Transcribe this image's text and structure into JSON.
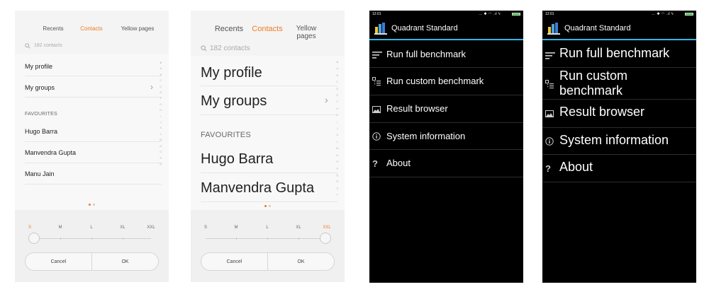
{
  "miui_panel_small": {
    "tabs": [
      "Recents",
      "Contacts",
      "Yellow pages"
    ],
    "active_tab": "Contacts",
    "search_placeholder": "182 contacts",
    "rows": {
      "profile": "My profile",
      "groups": "My groups"
    },
    "section_header": "FAVOURITES",
    "favourites": [
      "Hugo Barra",
      "Manvendra Gupta",
      "Manu Jain"
    ],
    "alphabet": [
      "★",
      "A",
      "B",
      "C",
      "D",
      "E",
      "F",
      "G",
      "H",
      "I",
      "J",
      "K",
      "L",
      "M",
      "N",
      "O",
      "P",
      "Q"
    ],
    "font_sizes": [
      "S",
      "M",
      "L",
      "XL",
      "XXL"
    ],
    "selected_size": "S",
    "selected_size_index": 0,
    "cancel_label": "Cancel",
    "ok_label": "OK"
  },
  "miui_panel_large": {
    "tabs": [
      "Recents",
      "Contacts",
      "Yellow pages"
    ],
    "active_tab": "Contacts",
    "search_placeholder": "182 contacts",
    "rows": {
      "profile": "My profile",
      "groups": "My groups"
    },
    "section_header": "FAVOURITES",
    "favourites": [
      "Hugo Barra",
      "Manvendra Gupta"
    ],
    "alphabet": [
      "★",
      "A",
      "B",
      "C",
      "D",
      "E",
      "F",
      "G",
      "H",
      "I",
      "J",
      "K",
      "L",
      "M",
      "N",
      "O",
      "P",
      "Q",
      "R",
      "S",
      "T"
    ],
    "font_sizes": [
      "S",
      "M",
      "L",
      "XL",
      "XXL"
    ],
    "selected_size": "XXL",
    "selected_size_index": 4,
    "cancel_label": "Cancel",
    "ok_label": "OK"
  },
  "quadrant_normal": {
    "status_time": "12:01",
    "app_title": "Quadrant Standard",
    "menu": [
      {
        "label": "Run full benchmark",
        "icon": "list-icon"
      },
      {
        "label": "Run custom benchmark",
        "icon": "checklist-icon"
      },
      {
        "label": "Result browser",
        "icon": "image-icon"
      },
      {
        "label": "System information",
        "icon": "info-icon"
      },
      {
        "label": "About",
        "icon": "question-icon"
      }
    ]
  },
  "quadrant_large": {
    "status_time": "12:01",
    "app_title": "Quadrant Standard",
    "menu": [
      {
        "label": "Run full benchmark",
        "icon": "list-icon"
      },
      {
        "label": "Run custom benchmark",
        "icon": "checklist-icon"
      },
      {
        "label": "Result browser",
        "icon": "image-icon"
      },
      {
        "label": "System information",
        "icon": "info-icon"
      },
      {
        "label": "About",
        "icon": "question-icon"
      }
    ]
  },
  "colors": {
    "accent_orange": "#f07a22",
    "holo_blue": "#33b5e5",
    "battery_green": "#33cc33"
  }
}
